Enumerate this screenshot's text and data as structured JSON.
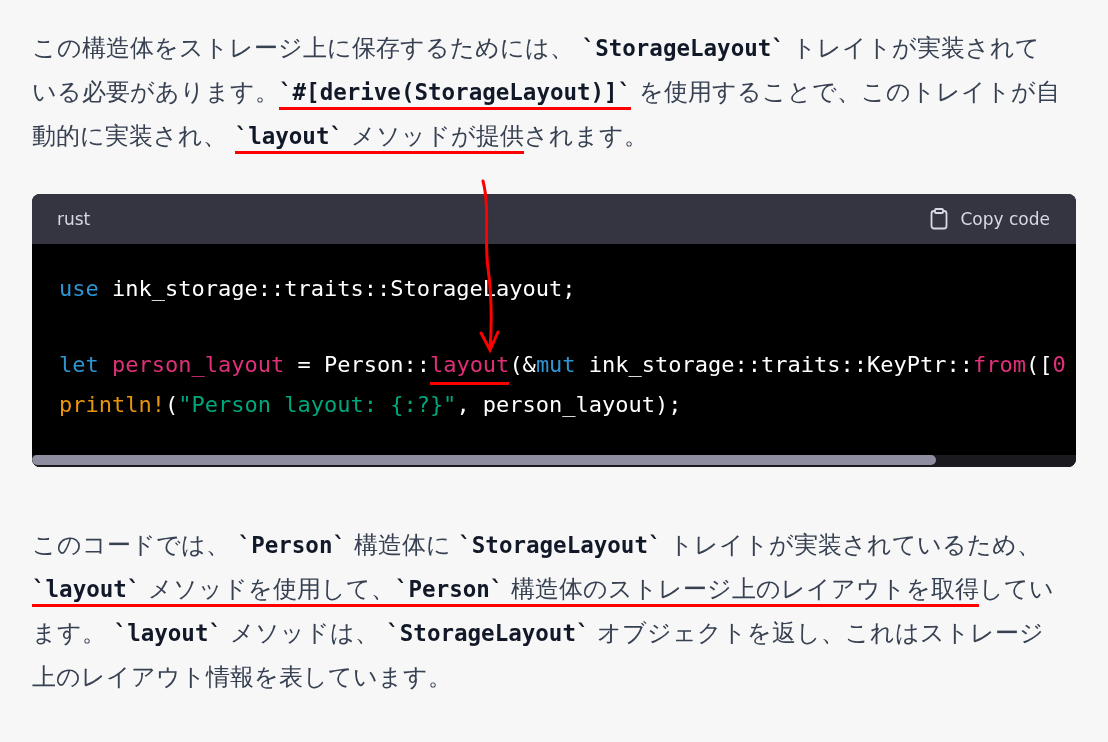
{
  "paragraphs": [
    {
      "lines": [
        [
          {
            "kind": "text",
            "text": "この構造体をストレージ上に保存するためには、 ",
            "marked": false
          },
          {
            "kind": "code",
            "text": "`StorageLayout`",
            "marked": false
          },
          {
            "kind": "text",
            "text": " トレイトが実装されて",
            "marked": false
          }
        ],
        [
          {
            "kind": "text",
            "text": "いる必要があります。",
            "marked": false
          },
          {
            "kind": "code",
            "text": "`#[derive(StorageLayout)]`",
            "marked": true
          },
          {
            "kind": "text",
            "text": " を使用することで、このトレイトが自",
            "marked": false
          }
        ],
        [
          {
            "kind": "text",
            "text": "動的に実装され、 ",
            "marked": false
          },
          {
            "kind": "code",
            "text": "`layout`",
            "marked": true
          },
          {
            "kind": "text",
            "text": " メソッドが提供",
            "marked": true
          },
          {
            "kind": "text",
            "text": "されます。",
            "marked": false
          }
        ]
      ]
    }
  ],
  "code_block": {
    "language": "rust",
    "copy_label": "Copy code",
    "lines": [
      [
        {
          "kind": "keyword",
          "text": "use",
          "marked": false
        },
        {
          "kind": "plain",
          "text": " ink_storage::traits::StorageLayout;",
          "marked": false
        }
      ],
      [
        {
          "kind": "keyword",
          "text": "let",
          "marked": false
        },
        {
          "kind": "name",
          "text": " person_layout",
          "marked": false
        },
        {
          "kind": "plain",
          "text": " = Person::",
          "marked": false
        },
        {
          "kind": "name",
          "text": "layout",
          "marked": true
        },
        {
          "kind": "plain",
          "text": "(&",
          "marked": false
        },
        {
          "kind": "keyword",
          "text": "mut",
          "marked": false
        },
        {
          "kind": "plain",
          "text": " ink_storage::traits::KeyPtr::",
          "marked": false
        },
        {
          "kind": "name",
          "text": "from",
          "marked": false
        },
        {
          "kind": "plain",
          "text": "([",
          "marked": false
        },
        {
          "kind": "name",
          "text": "0",
          "marked": false
        }
      ],
      [
        {
          "kind": "macro",
          "text": "println!",
          "marked": false
        },
        {
          "kind": "plain",
          "text": "(",
          "marked": false
        },
        {
          "kind": "string",
          "text": "\"Person layout: {:?}\"",
          "marked": false
        },
        {
          "kind": "plain",
          "text": ", person_layout);",
          "marked": false
        }
      ]
    ]
  },
  "after_paragraphs": [
    {
      "lines": [
        [
          {
            "kind": "text",
            "text": "このコードでは、 ",
            "marked": false
          },
          {
            "kind": "code",
            "text": "`Person`",
            "marked": false
          },
          {
            "kind": "text",
            "text": " 構造体に ",
            "marked": false
          },
          {
            "kind": "code",
            "text": "`StorageLayout`",
            "marked": false
          },
          {
            "kind": "text",
            "text": " トレイトが実装されているため、",
            "marked": false
          }
        ],
        [
          {
            "kind": "code",
            "text": "`layout`",
            "marked": true
          },
          {
            "kind": "text",
            "text": " メソッドを使用して、",
            "marked": true
          },
          {
            "kind": "code",
            "text": "`Person`",
            "marked": true
          },
          {
            "kind": "text",
            "text": " 構造体のストレージ上のレイアウトを取得",
            "marked": true
          },
          {
            "kind": "text",
            "text": "してい",
            "marked": false
          }
        ],
        [
          {
            "kind": "text",
            "text": "ます。 ",
            "marked": false
          },
          {
            "kind": "code",
            "text": "`layout`",
            "marked": false
          },
          {
            "kind": "text",
            "text": " メソッドは、 ",
            "marked": false
          },
          {
            "kind": "code",
            "text": "`StorageLayout`",
            "marked": false
          },
          {
            "kind": "text",
            "text": " オブジェクトを返し、これはストレージ",
            "marked": false
          }
        ],
        [
          {
            "kind": "text",
            "text": "上のレイアウト情報を表しています。",
            "marked": false
          }
        ]
      ]
    }
  ]
}
